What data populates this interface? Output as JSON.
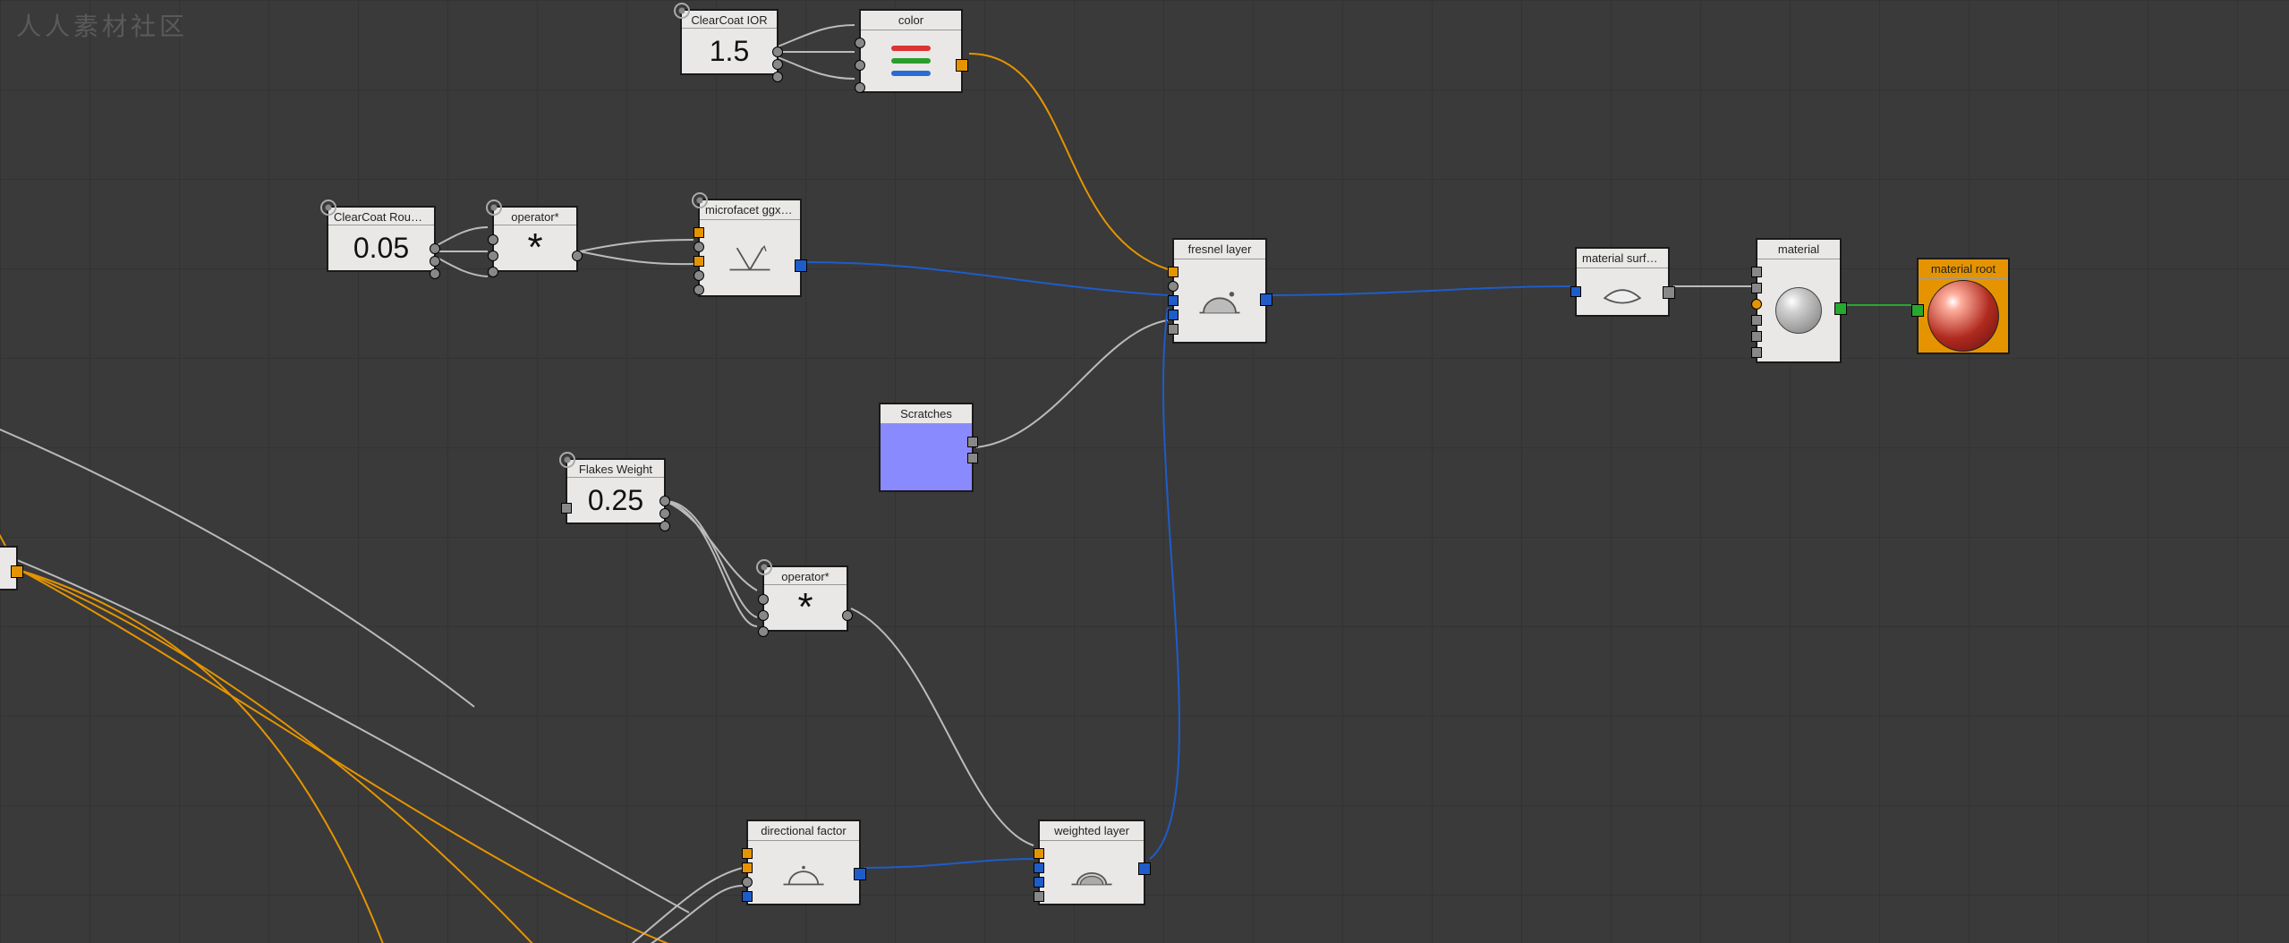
{
  "watermark": "人人素材社区",
  "nodes": {
    "clearCoatIOR": {
      "title": "ClearCoat IOR",
      "value": "1.5"
    },
    "color": {
      "title": "color"
    },
    "clearCoatRough": {
      "title": "ClearCoat Roughn…",
      "value": "0.05"
    },
    "operator1": {
      "title": "operator*",
      "symbol": "*"
    },
    "microfacet": {
      "title": "microfacet ggx sm…"
    },
    "fresnel": {
      "title": "fresnel layer"
    },
    "materialSurface": {
      "title": "material surface"
    },
    "material": {
      "title": "material"
    },
    "materialRoot": {
      "title": "material root"
    },
    "scratches": {
      "title": "Scratches"
    },
    "flakesWeight": {
      "title": "Flakes Weight",
      "value": "0.25"
    },
    "operator2": {
      "title": "operator*",
      "symbol": "*"
    },
    "directionalFactor": {
      "title": "directional factor"
    },
    "weightedLayer": {
      "title": "weighted layer"
    }
  },
  "colorSwatches": {
    "r": "#d33",
    "g": "#2a9d2a",
    "b": "#2a6cd3"
  }
}
